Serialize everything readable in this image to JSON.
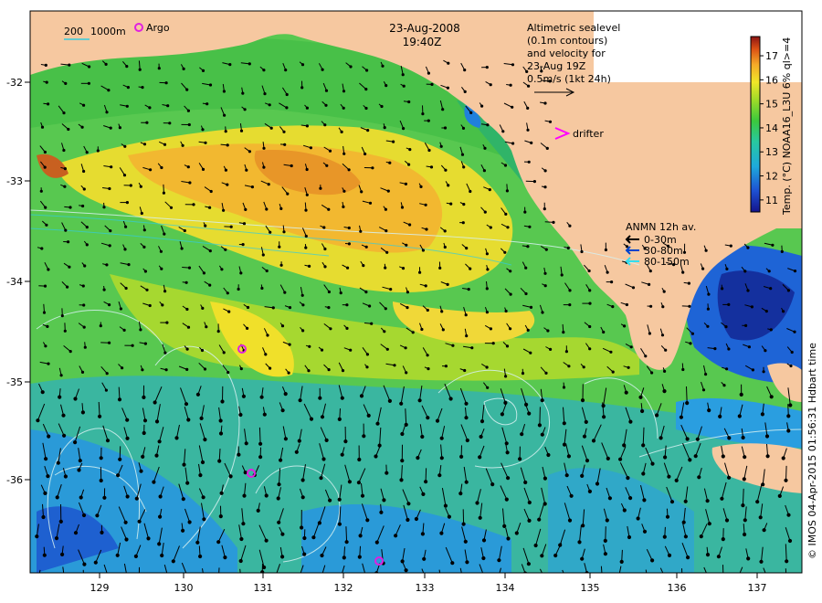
{
  "title": {
    "date": "23-Aug-2008",
    "time": "19:40Z"
  },
  "depth_legend": {
    "contour_a": "200",
    "contour_b": "1000m"
  },
  "argo_label": "Argo",
  "altimetry_note": [
    "Altimetric sealevel",
    "(0.1m contours)",
    "and velocity for",
    "23-Aug 19Z",
    "0.5m/s (1kt 24h)"
  ],
  "drifter_label": "drifter",
  "anmn": {
    "title": "ANMN 12h av.",
    "items": [
      {
        "label": "0-30m",
        "color": "#000000"
      },
      {
        "label": "30-80m",
        "color": "#0044cc"
      },
      {
        "label": "80-150m",
        "color": "#33ddee"
      }
    ]
  },
  "colorbar": {
    "label": "Temp. (°C) NOAA16_L3U 6% ql>=4",
    "ticks": [
      "11",
      "12",
      "13",
      "14",
      "15",
      "16",
      "17"
    ],
    "vmin": 10.5,
    "vmax": 17.8
  },
  "axes": {
    "x_ticks": [
      "129",
      "130",
      "131",
      "132",
      "133",
      "134",
      "135",
      "136",
      "137"
    ],
    "y_ticks": [
      "-32",
      "-33",
      "-34",
      "-35",
      "-36"
    ]
  },
  "credit": "© IMOS 04-Apr-2015 01:56:31 Hdbart time",
  "colors": {
    "land": "#f6c8a0",
    "argo": "#e020e0",
    "drifter": "#ff00ff"
  }
}
